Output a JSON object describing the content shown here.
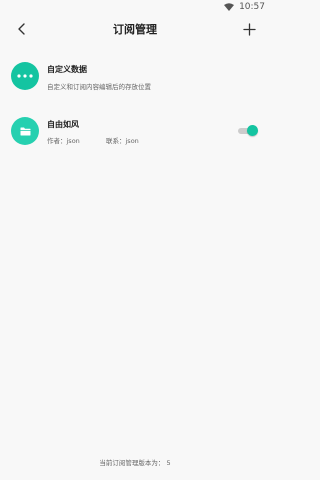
{
  "status_bar": {
    "time": "10:57"
  },
  "toolbar": {
    "title": "订阅管理"
  },
  "items": [
    {
      "title": "自定义数据",
      "subtitle": "自定义和订阅内容编辑后的存放位置"
    },
    {
      "title": "自由如风",
      "author": "作者：json",
      "contact": "联系：json",
      "enabled": true
    }
  ],
  "footer": {
    "version_text": "当前订阅管理版本为：  5"
  },
  "colors": {
    "accent": "#14c4a1",
    "background": "#f8f8f8"
  }
}
